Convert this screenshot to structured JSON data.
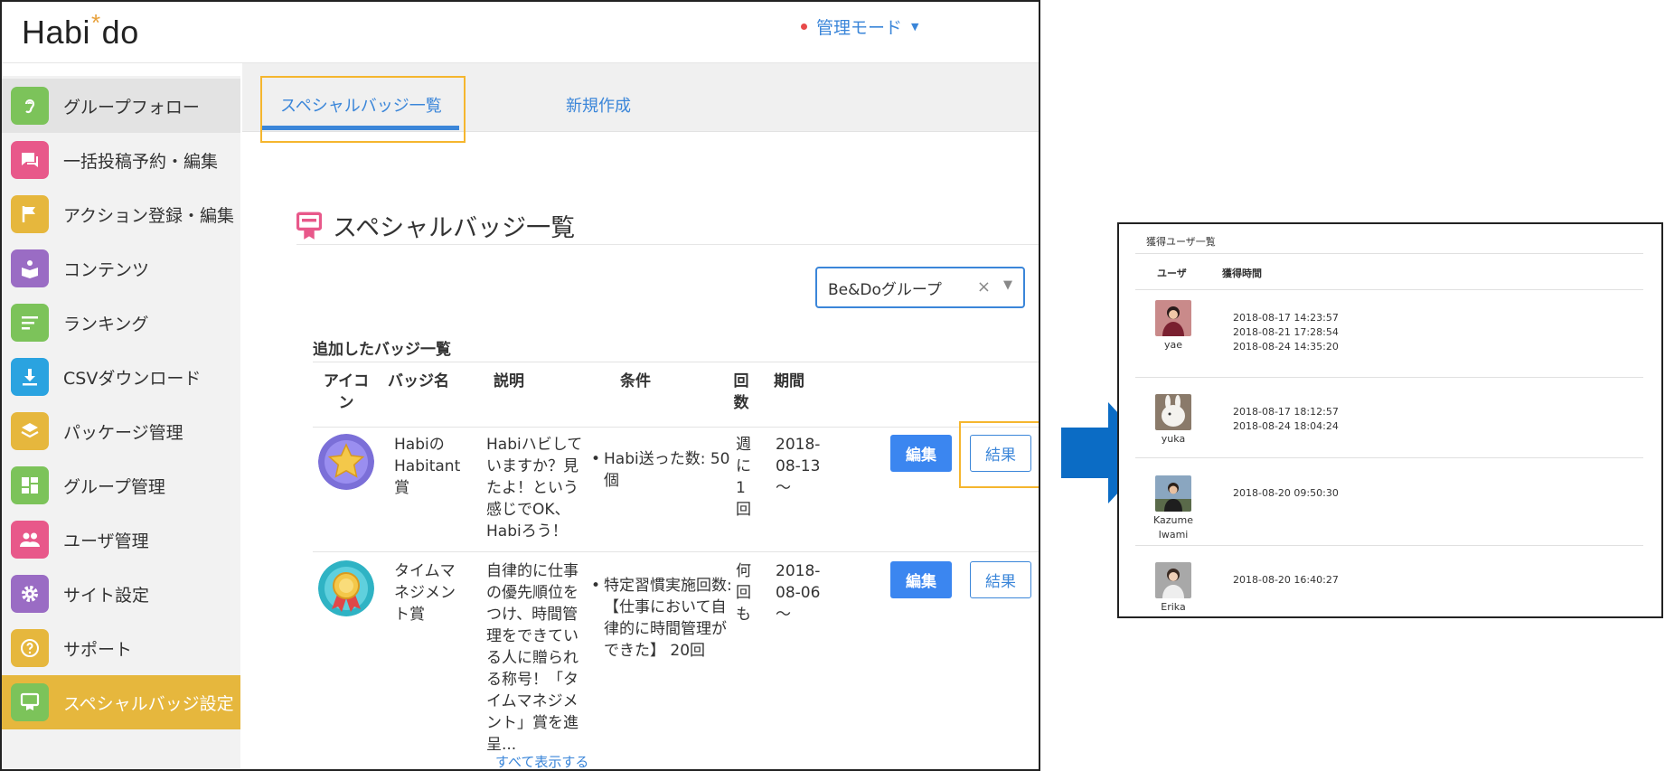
{
  "app": {
    "logo_left": "Habi",
    "logo_star": "*",
    "logo_right": "do",
    "mode_label": "管理モード"
  },
  "sidebar": {
    "items": [
      {
        "label": "グループフォロー",
        "icon": "ear-icon",
        "color": "#7cc35a"
      },
      {
        "label": "一括投稿予約・編集",
        "icon": "chat-icon",
        "color": "#e8588a"
      },
      {
        "label": "アクション登録・編集",
        "icon": "flag-icon",
        "color": "#e6b73d"
      },
      {
        "label": "コンテンツ",
        "icon": "book-icon",
        "color": "#9a6cc4"
      },
      {
        "label": "ランキング",
        "icon": "list-icon",
        "color": "#7cc35a"
      },
      {
        "label": "CSVダウンロード",
        "icon": "download-icon",
        "color": "#2aa3e0"
      },
      {
        "label": "パッケージ管理",
        "icon": "layers-icon",
        "color": "#e6b73d"
      },
      {
        "label": "グループ管理",
        "icon": "dashboard-icon",
        "color": "#7cc35a"
      },
      {
        "label": "ユーザ管理",
        "icon": "users-icon",
        "color": "#e8588a"
      },
      {
        "label": "サイト設定",
        "icon": "gear-icon",
        "color": "#9a6cc4"
      },
      {
        "label": "サポート",
        "icon": "help-icon",
        "color": "#e6b73d"
      },
      {
        "label": "スペシャルバッジ設定",
        "icon": "badge-icon",
        "color": "#7cc35a"
      }
    ]
  },
  "tabs": {
    "list_tab": "スペシャルバッジ一覧",
    "new_tab": "新規作成"
  },
  "page": {
    "title": "スペシャルバッジ一覧",
    "group_select": "Be&Doグループ",
    "section_title": "追加したバッジ一覧",
    "columns": {
      "icon_1": "アイコ",
      "icon_2": "ン",
      "name": "バッジ名",
      "desc": "説明",
      "cond": "条件",
      "count_1": "回",
      "count_2": "数",
      "period": "期間"
    },
    "rows": [
      {
        "name_lines": [
          "Habiの",
          "Habitant",
          "賞"
        ],
        "desc_lines": [
          "Habiハビして",
          "いますか？見",
          "たよ！という",
          "感じでOK、",
          "Habiろう！"
        ],
        "cond_lines": [
          "Habi送った数: 50",
          "個"
        ],
        "count_lines": [
          "週",
          "に",
          "1",
          "回"
        ],
        "period_lines": [
          "2018-",
          "08-13",
          "〜"
        ],
        "edit": "編集",
        "result": "結果"
      },
      {
        "name_lines": [
          "タイムマ",
          "ネジメン",
          "ト賞"
        ],
        "desc_lines": [
          "自律的に仕事",
          "の優先順位を",
          "つけ、時間管",
          "理をできてい",
          "る人に贈られ",
          "る称号！「タ",
          "イムマネジメ",
          "ント」賞を進",
          "呈..."
        ],
        "cond_lines": [
          "特定習慣実施回数:",
          "【仕事において自",
          "律的に時間管理が",
          "できた】 20回"
        ],
        "count_lines": [
          "何",
          "回",
          "も"
        ],
        "period_lines": [
          "2018-",
          "08-06",
          "〜"
        ],
        "edit": "編集",
        "result": "結果",
        "show_all": "すべて表示する"
      }
    ]
  },
  "panel": {
    "title": "獲得ユーザ一覧",
    "col_user": "ユーザ",
    "col_time": "獲得時間",
    "users": [
      {
        "name_lines": [
          "yae"
        ],
        "times": [
          "2018-08-17 14:23:57",
          "2018-08-21 17:28:54",
          "2018-08-24 14:35:20"
        ]
      },
      {
        "name_lines": [
          "yuka"
        ],
        "times": [
          "2018-08-17 18:12:57",
          "2018-08-24 18:04:24"
        ]
      },
      {
        "name_lines": [
          "Kazume",
          "Iwami"
        ],
        "times": [
          "2018-08-20 09:50:30"
        ]
      },
      {
        "name_lines": [
          "Erika"
        ],
        "times": [
          "2018-08-20 16:40:27"
        ]
      }
    ]
  },
  "colors": {
    "accent": "#3b86d9",
    "selected": "#e6b73d",
    "highlight_box": "#f5b62e",
    "arrow": "#0b6cc5"
  }
}
